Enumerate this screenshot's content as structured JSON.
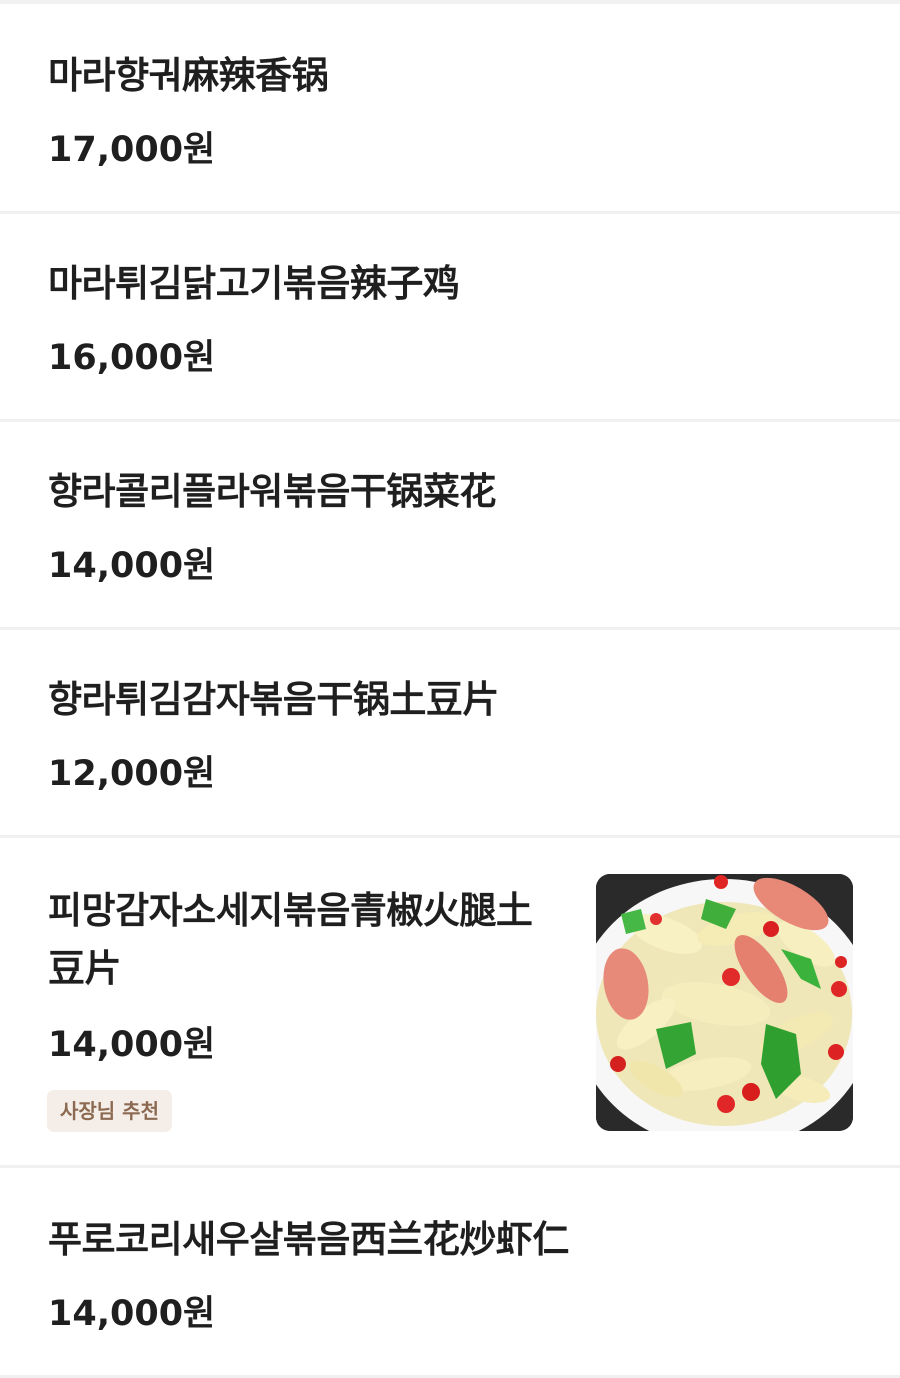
{
  "menu": {
    "items": [
      {
        "name": "마라향궈麻辣香锅",
        "price": "17,000원"
      },
      {
        "name": "마라튀김닭고기볶음辣子鸡",
        "price": "16,000원"
      },
      {
        "name": "향라콜리플라워볶음干锅菜花",
        "price": "14,000원"
      },
      {
        "name": "향라튀김감자볶음干锅土豆片",
        "price": "12,000원"
      },
      {
        "name": "피망감자소세지볶음青椒火腿土豆片",
        "price": "14,000원",
        "badge": "사장님 추천",
        "image": "stir-fried potato, green pepper and sausage dish"
      },
      {
        "name": "푸로코리새우살볶음西兰花炒虾仁",
        "price": "14,000원"
      }
    ]
  },
  "colors": {
    "text": "#1f1f1f",
    "divider": "#f0f0f0",
    "badge_bg": "#f5eee8",
    "badge_text": "#8c6a52"
  }
}
